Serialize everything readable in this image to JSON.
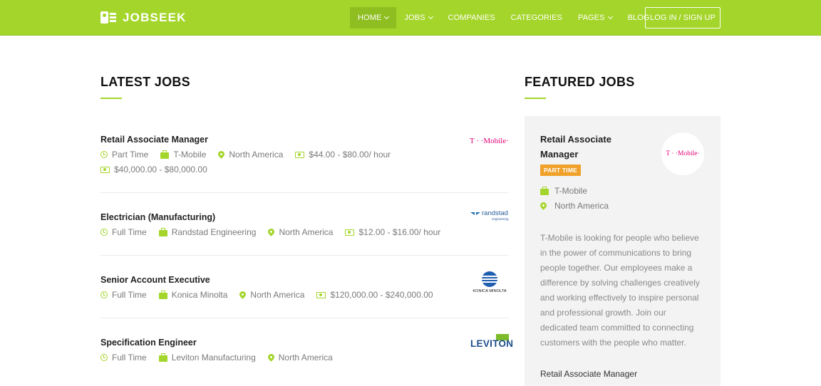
{
  "brand": {
    "name": "JOBSEEK"
  },
  "nav": {
    "items": [
      {
        "label": "HOME",
        "dropdown": true,
        "active": true
      },
      {
        "label": "JOBS",
        "dropdown": true
      },
      {
        "label": "COMPANIES",
        "dropdown": false
      },
      {
        "label": "CATEGORIES",
        "dropdown": false
      },
      {
        "label": "PAGES",
        "dropdown": true
      },
      {
        "label": "BLOG",
        "dropdown": false
      }
    ],
    "login_label": "LOG IN / SIGN UP"
  },
  "colors": {
    "accent": "#a4d52a",
    "accent_dark": "#8fbe21",
    "badge": "#f0a12a",
    "panel": "#f3f3f3"
  },
  "latest": {
    "heading": "LATEST JOBS",
    "jobs": [
      {
        "title": "Retail Associate Manager",
        "type": "Part Time",
        "company": "T-Mobile",
        "location": "North America",
        "rate": "$44.00 - $80.00/ hour",
        "salary": "$40,000.00 - $80,000.00",
        "logo_text": "T · ·Mobile·"
      },
      {
        "title": "Electrician (Manufacturing)",
        "type": "Full Time",
        "company": "Randstad Engineering",
        "location": "North America",
        "rate": "$12.00 - $16.00/ hour",
        "logo_text": "randstad",
        "logo_sub": "engineering"
      },
      {
        "title": "Senior Account Executive",
        "type": "Full Time",
        "company": "Konica Minolta",
        "location": "North America",
        "salary": "$120,000.00 - $240,000.00",
        "logo_text": "KONICA MINOLTA"
      },
      {
        "title": "Specification Engineer",
        "type": "Full Time",
        "company": "Leviton Manufacturing",
        "location": "North America",
        "logo_text": "LEVITON"
      }
    ]
  },
  "featured": {
    "heading": "FEATURED JOBS",
    "title": "Retail Associate Manager",
    "badge": "PART TIME",
    "company": "T-Mobile",
    "location": "North America",
    "logo_text": "T · ·Mobile·",
    "description": "T-Mobile is looking for people who believe in the power of communications to bring people together. Our employees make a difference by solving challenges creatively and working effectively to inspire personal and professional growth. Join our dedicated team committed to connecting customers with the people who matter.",
    "next_title": "Retail Associate Manager"
  }
}
